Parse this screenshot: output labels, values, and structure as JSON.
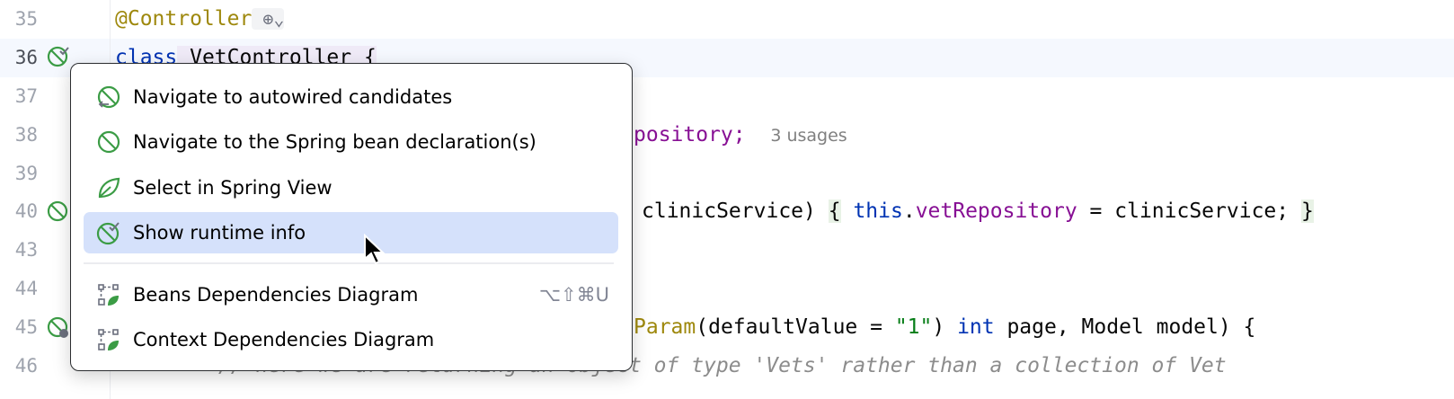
{
  "gutter": {
    "line_numbers": [
      "35",
      "36",
      "37",
      "38",
      "39",
      "40",
      "43",
      "44",
      "45",
      "46"
    ]
  },
  "code": {
    "line35": {
      "annotation": "@Controller"
    },
    "line36": {
      "keyword": "class",
      "name": " VetController {"
    },
    "line38": {
      "field": "pository;",
      "hint": "3 usages"
    },
    "line40": {
      "a": "clinicService) ",
      "b": "{",
      "c": " ",
      "kw": "this",
      "d": ".",
      "field": "vetRepository",
      "e": " = clinicService; ",
      "f": "}"
    },
    "line45": {
      "ann": "Param",
      "a": "(defaultValue = ",
      "str": "\"1\"",
      "b": ") ",
      "kw": "int",
      "c": " page, Model model) {"
    },
    "line46": {
      "comment": "// here we are returning an object of type 'Vets' rather than a collection of Vet"
    }
  },
  "menu": {
    "items": [
      {
        "label": "Navigate to autowired candidates",
        "icon": "spring-autowired-icon"
      },
      {
        "label": "Navigate to the Spring bean declaration(s)",
        "icon": "spring-bean-icon"
      },
      {
        "label": "Select in Spring View",
        "icon": "spring-leaf-icon"
      },
      {
        "label": "Show runtime info",
        "icon": "spring-runtime-icon",
        "selected": true
      },
      {
        "label": "Beans Dependencies Diagram",
        "icon": "diagram-icon",
        "shortcut": "⌥⇧⌘U"
      },
      {
        "label": "Context Dependencies Diagram",
        "icon": "diagram-icon"
      }
    ]
  },
  "colors": {
    "accent_green": "#3b9c45",
    "selection": "#d5e1fb"
  }
}
